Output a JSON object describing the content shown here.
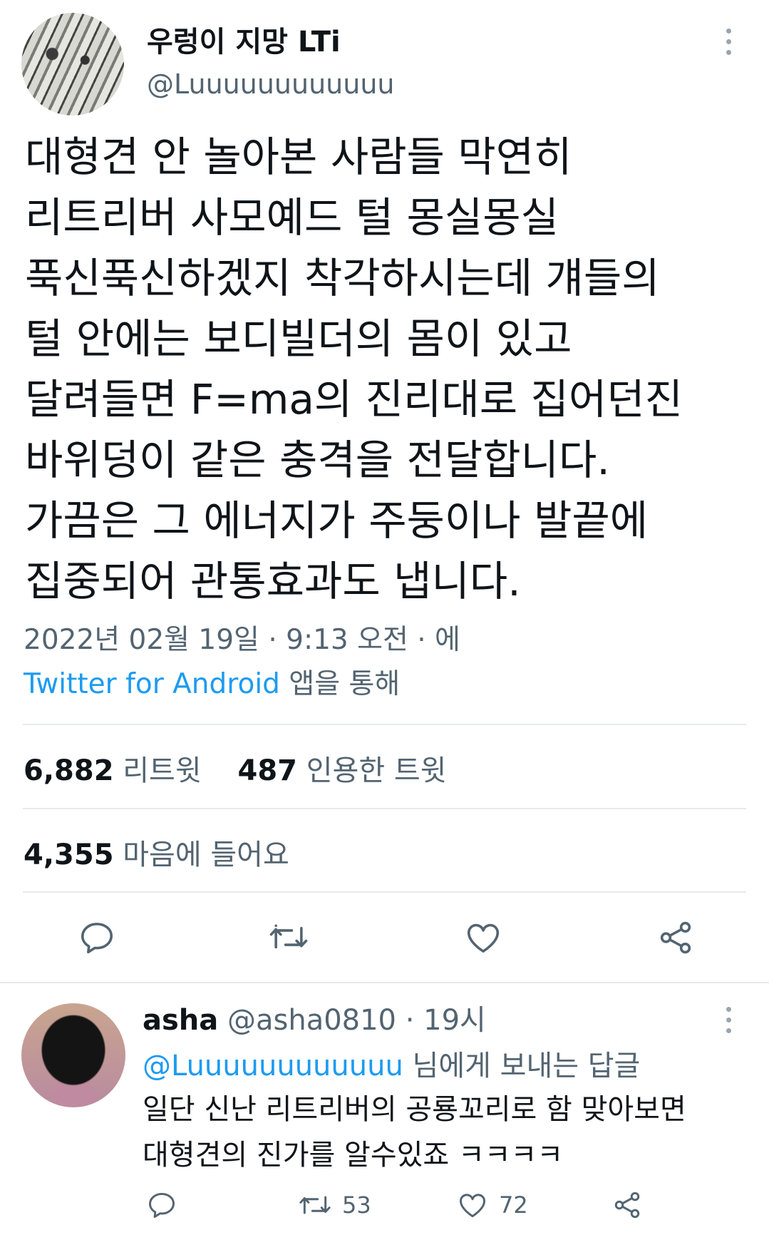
{
  "tweet": {
    "author_name": "우렁이 지망 LTi",
    "author_handle": "@Luuuuuuuuuuuu",
    "text_lines": [
      "대형견 안 놀아본 사람들 막연히",
      "리트리버 사모예드 털 몽실몽실",
      "푹신푹신하겠지 착각하시는데 걔들의",
      "털 안에는 보디빌더의 몸이 있고",
      "달려들면 F=ma의 진리대로 집어던진",
      "바위덩이 같은 충격을 전달합니다.",
      "가끔은 그 에너지가 주둥이나 발끝에",
      "집중되어 관통효과도 냅니다."
    ],
    "timestamp": "2022년 02월 19일 · 9:13 오전 · 에",
    "source_link": "Twitter for Android",
    "source_suffix": " 앱을 통해",
    "retweets_count": "6,882",
    "retweets_label": " 리트윗",
    "quotes_count": "487",
    "quotes_label": " 인용한 트윗",
    "likes_count": "4,355",
    "likes_label": " 마음에 들어요"
  },
  "icons": {
    "reply": "reply-icon",
    "retweet": "retweet-icon",
    "like": "heart-icon",
    "share": "share-icon",
    "more": "more-vertical-icon"
  },
  "reply": {
    "author_name": "asha",
    "author_handle": " @asha0810 · 19시",
    "mention": "@Luuuuuuuuuuuu",
    "mention_suffix": " 님에게 보내는 답글",
    "text_lines": [
      "일단 신난 리트리버의 공룡꼬리로 함 맞아보면",
      "대형견의 진가를 알수있죠 ㅋㅋㅋㅋ"
    ],
    "retweet_count": "53",
    "like_count": "72"
  },
  "colors": {
    "text": "#0f1419",
    "secondary": "#536471",
    "accent": "#1d9bf0",
    "divider": "#e7e9ea"
  }
}
